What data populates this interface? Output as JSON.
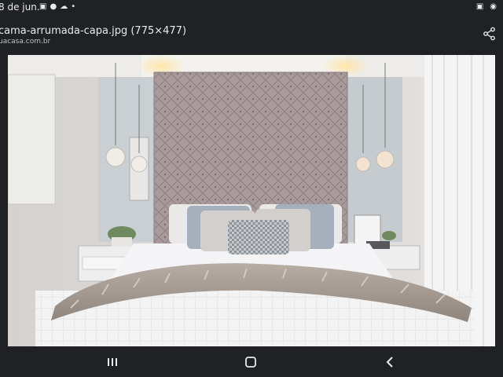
{
  "status": {
    "time": "8 de jun.",
    "left_icons": [
      "image-icon",
      "messenger-icon",
      "cloud-icon",
      "dot-icon"
    ],
    "right_icons": [
      "image-icon",
      "camera-icon"
    ]
  },
  "viewer": {
    "title": "cama-arrumada-capa.jpg (775×477)",
    "source": "uacasa.com.br",
    "share_icon": "share-icon"
  },
  "photo": {
    "subject": "bedroom-with-tufted-headboard"
  },
  "nav": {
    "recents_icon": "recents-icon",
    "home_icon": "home-icon",
    "back_icon": "back-icon"
  },
  "colors": {
    "background": "#202124",
    "text": "#e8eaed"
  }
}
